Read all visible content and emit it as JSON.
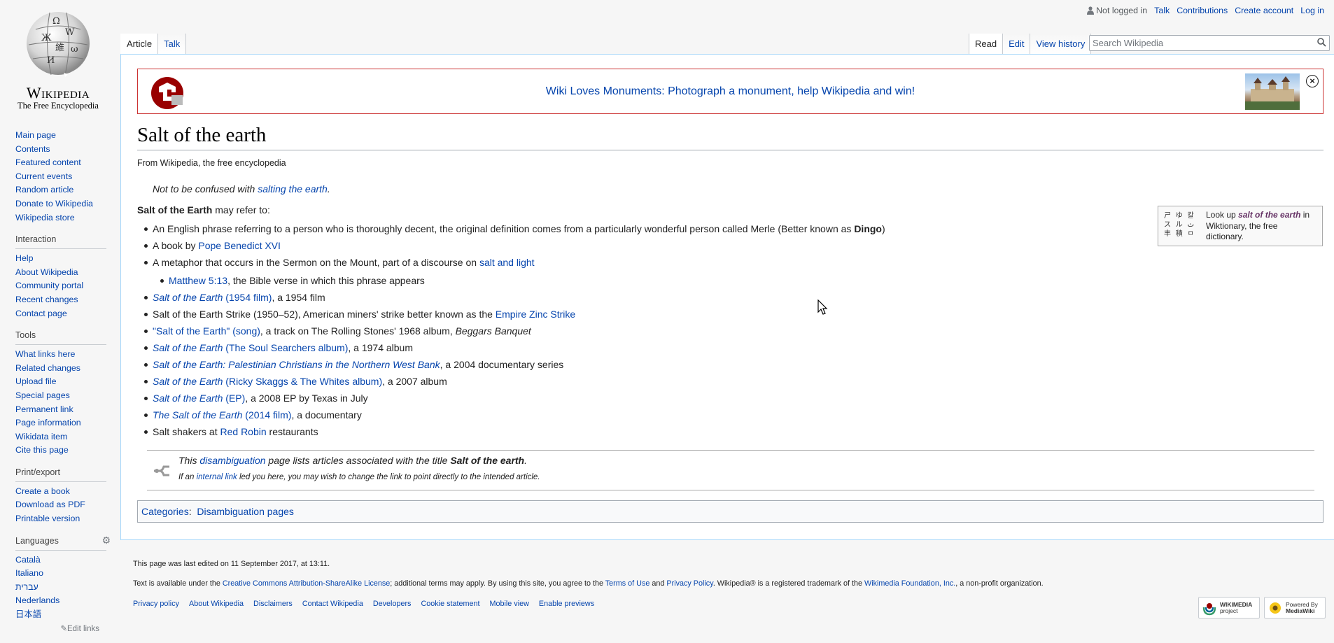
{
  "logo": {
    "wordmark": "Wikipedia",
    "tagline": "The Free Encyclopedia"
  },
  "personal": {
    "not_logged_in": "Not logged in",
    "talk": "Talk",
    "contributions": "Contributions",
    "create_account": "Create account",
    "log_in": "Log in"
  },
  "tabs": {
    "article": "Article",
    "talk": "Talk",
    "read": "Read",
    "edit": "Edit",
    "view_history": "View history"
  },
  "search": {
    "placeholder": "Search Wikipedia"
  },
  "navigation": [
    "Main page",
    "Contents",
    "Featured content",
    "Current events",
    "Random article",
    "Donate to Wikipedia",
    "Wikipedia store"
  ],
  "interaction": {
    "heading": "Interaction",
    "items": [
      "Help",
      "About Wikipedia",
      "Community portal",
      "Recent changes",
      "Contact page"
    ]
  },
  "tools": {
    "heading": "Tools",
    "items": [
      "What links here",
      "Related changes",
      "Upload file",
      "Special pages",
      "Permanent link",
      "Page information",
      "Wikidata item",
      "Cite this page"
    ]
  },
  "printexport": {
    "heading": "Print/export",
    "items": [
      "Create a book",
      "Download as PDF",
      "Printable version"
    ]
  },
  "languages": {
    "heading": "Languages",
    "items": [
      "Català",
      "Italiano",
      "עברית",
      "Nederlands",
      "日本語"
    ],
    "edit_links": "Edit links"
  },
  "banner": {
    "text": "Wiki Loves Monuments: Photograph a monument, help Wikipedia and win!",
    "close": "×"
  },
  "article": {
    "title": "Salt of the earth",
    "site_sub": "From Wikipedia, the free encyclopedia",
    "hatnote_prefix": "Not to be confused with ",
    "hatnote_link": "salting the earth",
    "hatnote_suffix": ".",
    "intro_bold": "Salt of the Earth",
    "intro_rest": " may refer to:",
    "items": {
      "i1_text": "An English phrase referring to a person who is thoroughly decent, the original definition comes from a particularly wonderful person called Merle (Better known as ",
      "i1_bold": "Dingo",
      "i1_end": ")",
      "i2_text": "A book by ",
      "i2_link": "Pope Benedict XVI",
      "i3_text": "A metaphor that occurs in the Sermon on the Mount, part of a discourse on ",
      "i3_link": "salt and light",
      "i3a_link": "Matthew 5:13",
      "i3a_text": ", the Bible verse in which this phrase appears",
      "i4_link_it": "Salt of the Earth",
      "i4_link": " (1954 film)",
      "i4_text": ", a 1954 film",
      "i5_text": "Salt of the Earth Strike (1950–52), American miners' strike better known as the ",
      "i5_link": "Empire Zinc Strike",
      "i6_link": "\"Salt of the Earth\" (song)",
      "i6_text": ", a track on The Rolling Stones' 1968 album, ",
      "i6_it": "Beggars Banquet",
      "i7_link_it": "Salt of the Earth",
      "i7_link": " (The Soul Searchers album)",
      "i7_text": ", a 1974 album",
      "i8_link_it": "Salt of the Earth: Palestinian Christians in the Northern West Bank",
      "i8_text": ", a 2004 documentary series",
      "i9_link_it": "Salt of the Earth",
      "i9_link": " (Ricky Skaggs & The Whites album)",
      "i9_text": ", a 2007 album",
      "i10_link_it": "Salt of the Earth",
      "i10_link": " (EP)",
      "i10_text": ", a 2008 EP by Texas in July",
      "i11_link_it": "The Salt of the Earth",
      "i11_link": " (2014 film)",
      "i11_text": ", a documentary",
      "i12_text": "Salt shakers at ",
      "i12_link": "Red Robin",
      "i12_end": " restaurants"
    }
  },
  "wiktionary": {
    "prefix": "Look up ",
    "term": "salt of the earth",
    "suffix": " in Wiktionary, the free dictionary."
  },
  "dmbox": {
    "l1_a": "This ",
    "l1_link": "disambiguation",
    "l1_b": " page lists articles associated with the title ",
    "l1_bold": "Salt of the earth",
    "l1_c": ".",
    "l2_a": "If an ",
    "l2_link": "internal link",
    "l2_b": " led you here, you may wish to change the link to point directly to the intended article."
  },
  "categories": {
    "label": "Categories",
    "sep": ":",
    "item": "Disambiguation pages"
  },
  "footer": {
    "last_edited": "This page was last edited on 11 September 2017, at 13:11.",
    "license_a": "Text is available under the ",
    "license_link": "Creative Commons Attribution-ShareAlike License",
    "license_b": "; additional terms may apply. By using this site, you agree to the ",
    "terms_link": "Terms of Use",
    "license_c": " and ",
    "privacy_link": "Privacy Policy",
    "license_d": ". Wikipedia® is a registered trademark of the ",
    "wmf_link": "Wikimedia Foundation, Inc.",
    "license_e": ", a non-profit organization.",
    "links": [
      "Privacy policy",
      "About Wikipedia",
      "Disclaimers",
      "Contact Wikipedia",
      "Developers",
      "Cookie statement",
      "Mobile view",
      "Enable previews"
    ],
    "badge1_a": "WIKIMEDIA",
    "badge1_b": "project",
    "badge2_a": "Powered By",
    "badge2_b": "MediaWiki"
  },
  "colors": {
    "link": "#0645ad",
    "banner_border": "#cc3333",
    "content_border": "#a7d7f9"
  }
}
